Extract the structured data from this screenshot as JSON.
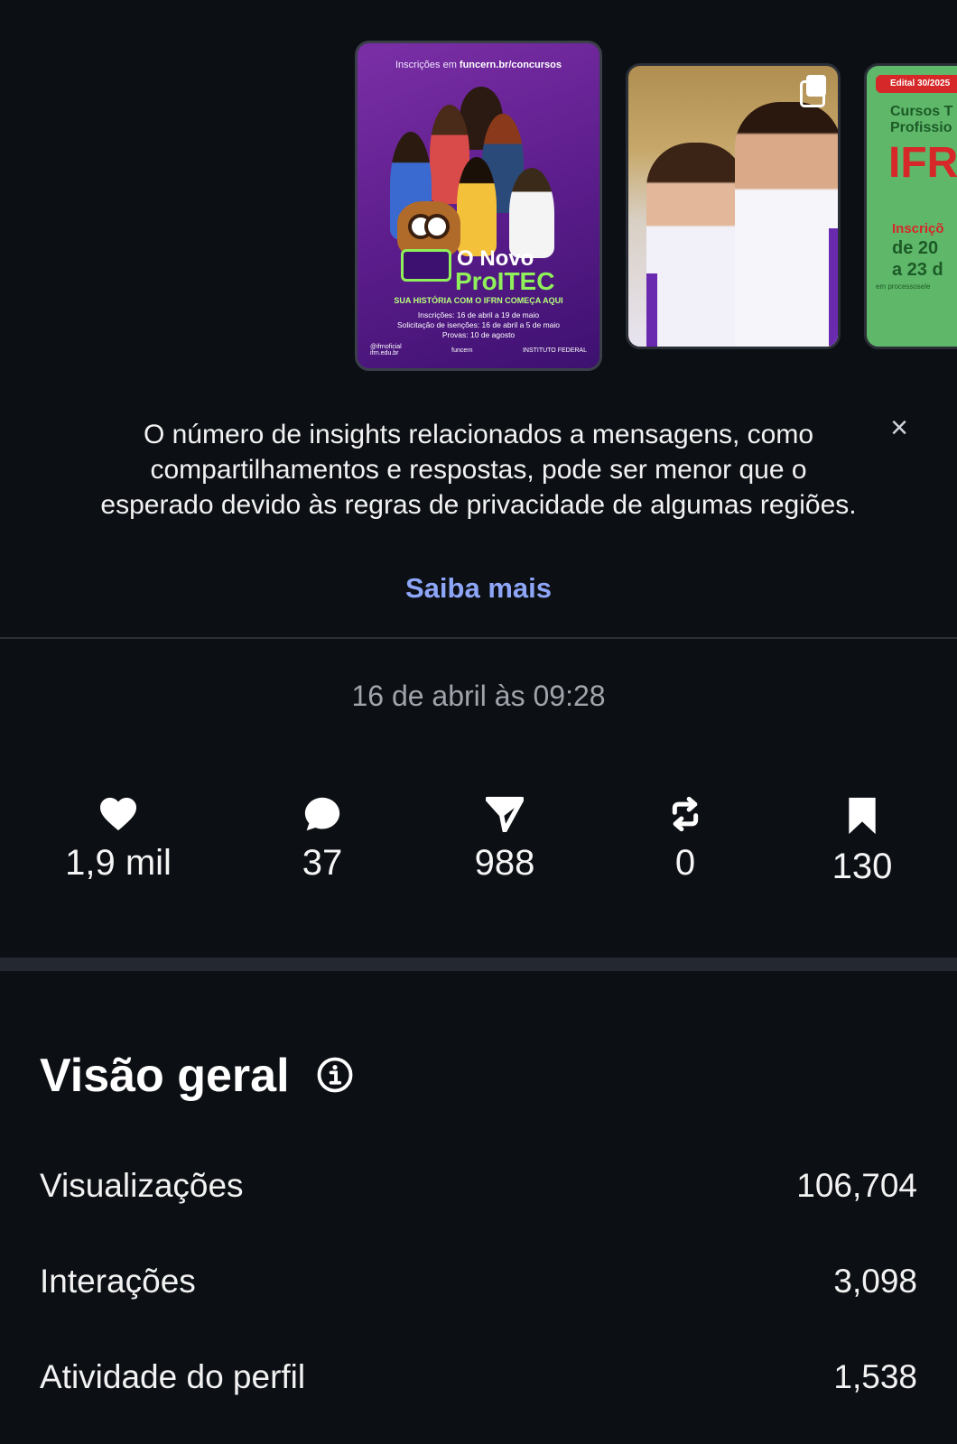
{
  "carousel": {
    "poster": {
      "top_text": "Inscrições em",
      "top_link": "funcern.br/concursos",
      "title_line1": "O Novo",
      "title_line2": "ProITEC",
      "subtitle": "SUA HISTÓRIA COM O IFRN COMEÇA AQUI",
      "info_lines": [
        "Inscrições: 16 de abril a 19 de maio",
        "Solicitação de isenções: 16 de abril a 5 de maio",
        "Provas: 10 de agosto"
      ],
      "footer_handle": "@ifrnoficial",
      "footer_site": "ifrn.edu.br",
      "footer_brand1": "funcern",
      "footer_brand2": "INSTITUTO FEDERAL"
    },
    "green": {
      "badge": "Edital 30/2025",
      "title": "Cursos T Profissio",
      "big": "IFR",
      "ins": "Inscriçõ",
      "date1": "de 20",
      "date2": "a 23 d",
      "proc": "em processosele"
    }
  },
  "notice": {
    "text": "O número de insights relacionados a mensagens, como compartilhamentos e respostas, pode ser menor que o esperado devido às regras de privacidade de algumas regiões.",
    "learn_more": "Saiba mais",
    "close": "×"
  },
  "timestamp": "16 de abril às 09:28",
  "stats": {
    "likes": "1,9 mil",
    "comments": "37",
    "shares": "988",
    "reposts": "0",
    "saves": "130"
  },
  "overview": {
    "title": "Visão geral",
    "metrics": [
      {
        "label": "Visualizações",
        "value": "106,704"
      },
      {
        "label": "Interações",
        "value": "3,098"
      },
      {
        "label": "Atividade do perfil",
        "value": "1,538"
      }
    ]
  },
  "colors": {
    "background": "#0c0f14",
    "link": "#8ea6f8",
    "muted": "#a0a4ab"
  }
}
